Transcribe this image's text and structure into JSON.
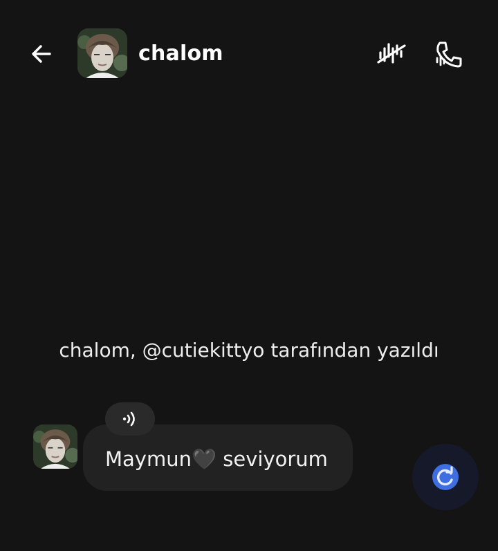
{
  "header": {
    "bot_name": "chalom",
    "icons": {
      "back": "arrow-left-icon",
      "voice_off": "voice-muted-icon",
      "call": "phone-call-icon"
    }
  },
  "chat": {
    "creator_note": "chalom, @cutiekittyo tarafından yazıldı",
    "messages": [
      {
        "sender": "chalom",
        "text": "Maymun🖤 seviyorum"
      }
    ]
  },
  "colors": {
    "background": "#141414",
    "bubble": "#222222",
    "chip": "#2a2a2a",
    "accent_blue": "#3f6ee0"
  }
}
